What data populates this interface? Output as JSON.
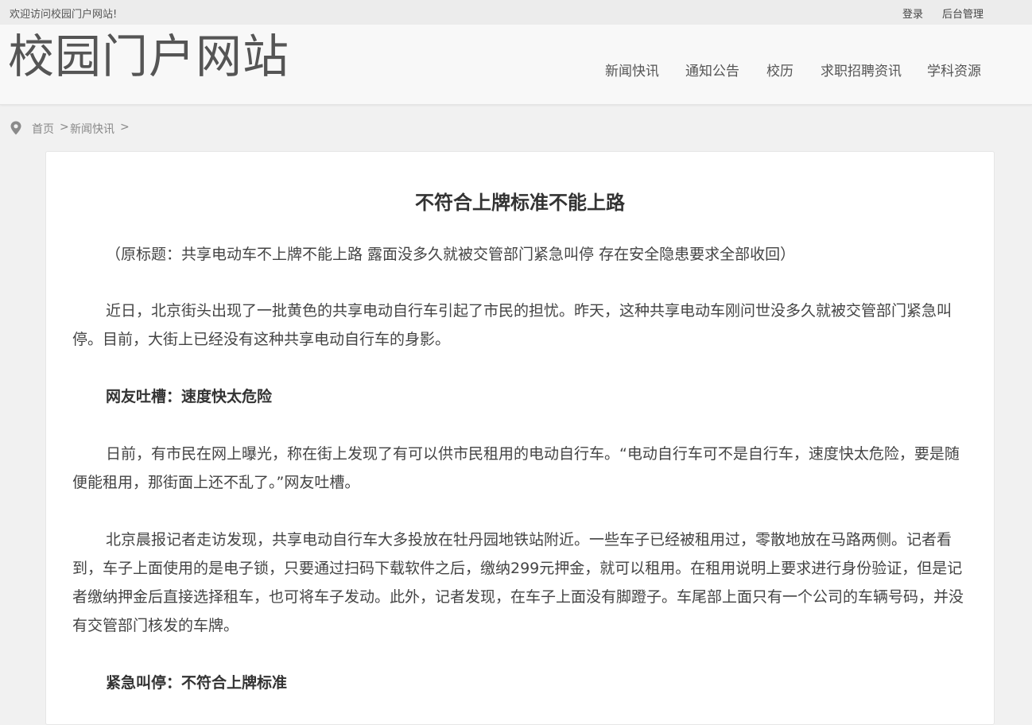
{
  "topbar": {
    "welcome": "欢迎访问校园门户网站!",
    "login": "登录",
    "admin": "后台管理"
  },
  "header": {
    "logo": "校园门户网站",
    "nav": [
      "新闻快讯",
      "通知公告",
      "校历",
      "求职招聘资讯",
      "学科资源"
    ]
  },
  "breadcrumb": {
    "icon": "location-pin-icon",
    "home": "首页",
    "separator": ">",
    "current": "新闻快讯"
  },
  "article": {
    "title": "不符合上牌标准不能上路",
    "paragraphs": [
      "（原标题：共享电动车不上牌不能上路 露面没多久就被交管部门紧急叫停 存在安全隐患要求全部收回）",
      "近日，北京街头出现了一批黄色的共享电动自行车引起了市民的担忧。昨天，这种共享电动车刚问世没多久就被交管部门紧急叫停。目前，大街上已经没有这种共享电动自行车的身影。",
      "网友吐槽：速度快太危险",
      "日前，有市民在网上曝光，称在街上发现了有可以供市民租用的电动自行车。“电动自行车可不是自行车，速度快太危险，要是随便能租用，那街面上还不乱了。”网友吐槽。",
      "北京晨报记者走访发现，共享电动自行车大多投放在牡丹园地铁站附近。一些车子已经被租用过，零散地放在马路两侧。记者看到，车子上面使用的是电子锁，只要通过扫码下载软件之后，缴纳299元押金，就可以租用。在租用说明上要求进行身份验证，但是记者缴纳押金后直接选择租车，也可将车子发动。此外，记者发现，在车子上面没有脚蹬子。车尾部上面只有一个公司的车辆号码，并没有交管部门核发的车牌。",
      "紧急叫停：不符合上牌标准"
    ]
  }
}
